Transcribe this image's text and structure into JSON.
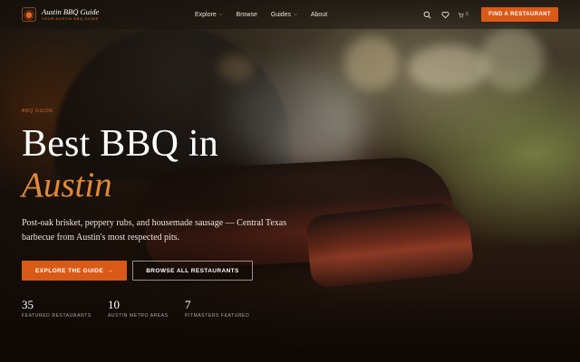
{
  "brand": {
    "name": "Austin BBQ Guide",
    "tagline": "YOUR AUSTIN BBQ GUIDE"
  },
  "nav": {
    "links": [
      {
        "label": "Explore",
        "has_dropdown": true
      },
      {
        "label": "Browse",
        "has_dropdown": false
      },
      {
        "label": "Guides",
        "has_dropdown": true
      },
      {
        "label": "About",
        "has_dropdown": false
      }
    ],
    "icons": [
      "search-icon",
      "heart-icon",
      "cart-icon"
    ],
    "cart_count": "0",
    "cta_label": "FIND A RESTAURANT"
  },
  "hero": {
    "eyebrow": "BBQ GUIDE",
    "title": "Best BBQ in",
    "title_accent": "Austin",
    "lede": "Post-oak brisket, peppery rubs, and housemade sausage — Central Texas barbecue from Austin's most respected pits.",
    "primary_button": "EXPLORE THE GUIDE",
    "primary_arrow": "→",
    "secondary_button": "BROWSE ALL RESTAURANTS",
    "stats": [
      {
        "value": "35",
        "label": "FEATURED RESTAURANTS"
      },
      {
        "value": "10",
        "label": "AUSTIN METRO AREAS"
      },
      {
        "value": "7",
        "label": "PITMASTERS FEATURED"
      }
    ]
  },
  "colors": {
    "accent": "#d95a16",
    "accent_text": "#e08a3a"
  }
}
